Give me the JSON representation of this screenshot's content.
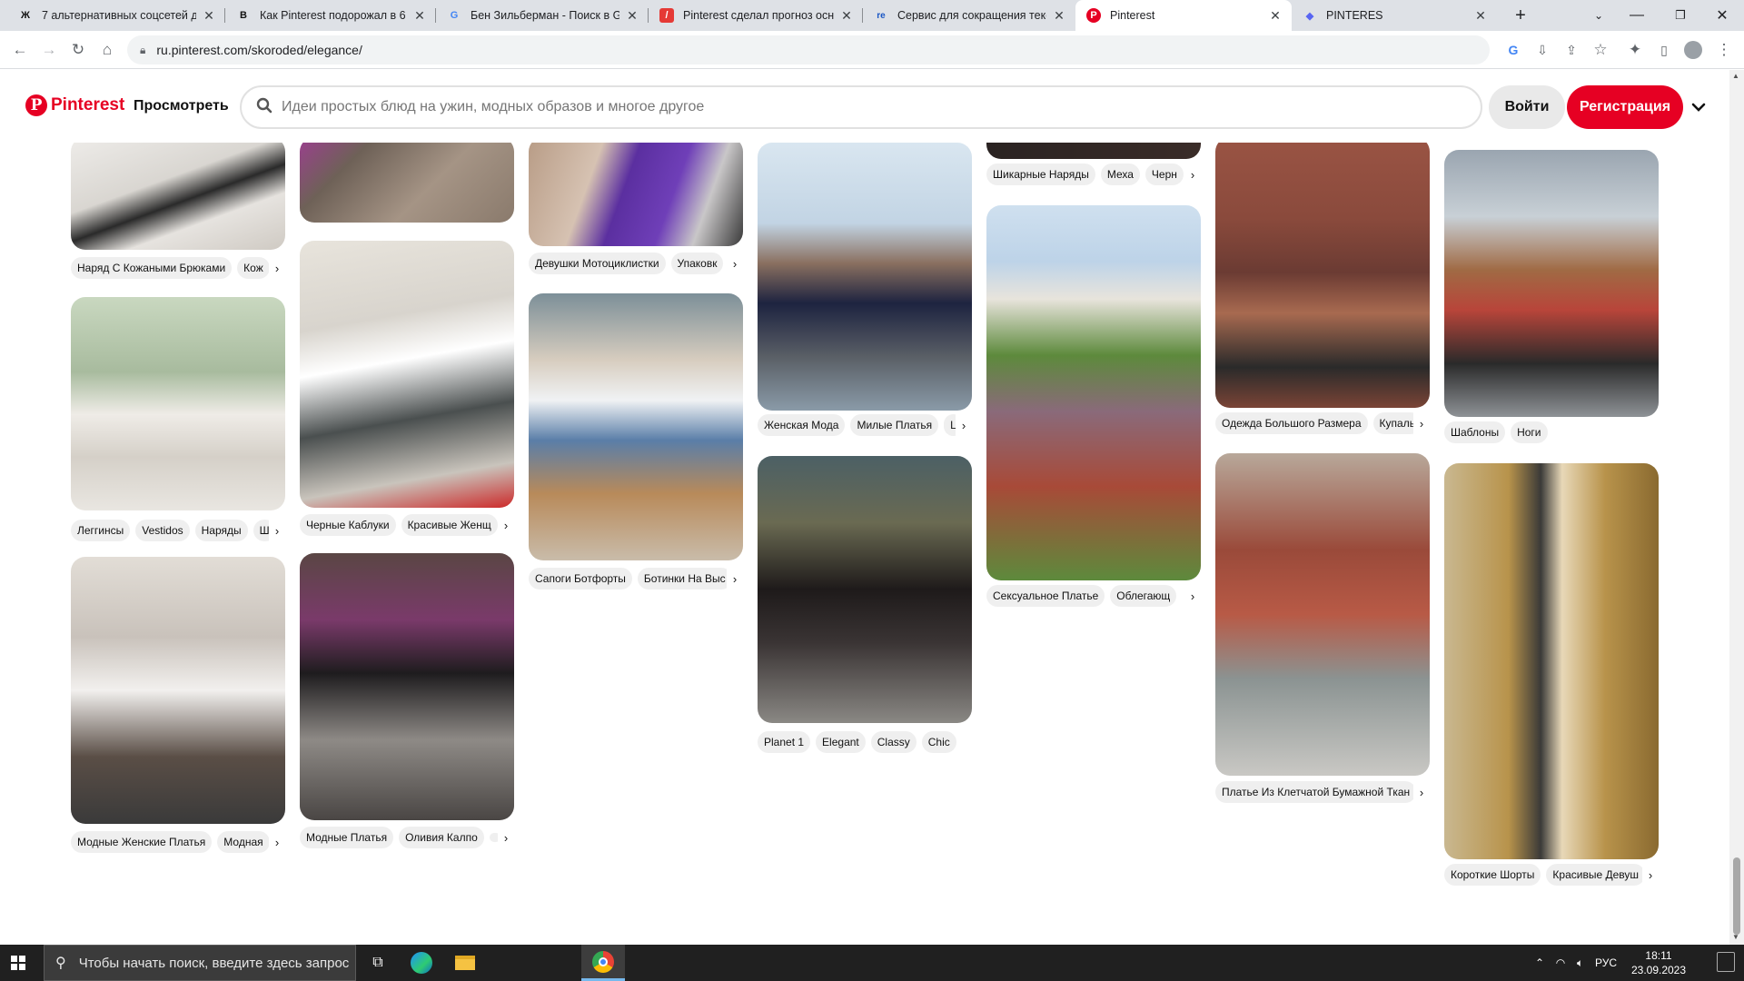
{
  "browser": {
    "tabs": [
      {
        "title": "7 альтернативных соцсетей дл",
        "favicon": "Ж",
        "fav_bg": "#ffffff",
        "fav_fg": "#111111"
      },
      {
        "title": "Как Pinterest подорожал в 6 р",
        "favicon": "B",
        "fav_bg": "#ffffff",
        "fav_fg": "#111111"
      },
      {
        "title": "Бен Зильберман - Поиск в Goo",
        "favicon": "G",
        "fav_bg": "#ffffff",
        "fav_fg": "#4285f4"
      },
      {
        "title": "Pinterest сделал прогноз осно",
        "favicon": "/",
        "fav_bg": "#e53935",
        "fav_fg": "#ffffff"
      },
      {
        "title": "Сервис для сокращения текста",
        "favicon": "re",
        "fav_bg": "#ffffff",
        "fav_fg": "#1a56c4"
      },
      {
        "title": "Pinterest",
        "favicon": "P",
        "fav_bg": "#e60023",
        "fav_fg": "#ffffff"
      },
      {
        "title": "PINTERES",
        "favicon": "◆",
        "fav_bg": "#ffffff",
        "fav_fg": "#5865f2"
      }
    ],
    "active_tab": 5,
    "url": "ru.pinterest.com/skoroded/elegance/"
  },
  "header": {
    "logo_text": "Pinterest",
    "browse_label": "Просмотреть",
    "search_placeholder": "Идеи простых блюд на ужин, модных образов и многое другое",
    "login_label": "Войти",
    "signup_label": "Регистрация"
  },
  "pins": {
    "col1": [
      {
        "tags": [
          "Наряд С Кожаными Брюками",
          "Кож"
        ],
        "colors": [
          "#e8e6e3",
          "#2b2b2b"
        ]
      },
      {
        "tags": [
          "Леггинсы",
          "Vestidos",
          "Наряды",
          "Ш"
        ],
        "colors": [
          "#b8c9b0",
          "#e9e6e1"
        ]
      },
      {
        "tags": [
          "Модные Женские Платья",
          "Модная"
        ],
        "colors": [
          "#c9c2bb",
          "#3a3a3a"
        ]
      }
    ],
    "col2": [
      {
        "tags": [],
        "colors": [
          "#7a6b5f",
          "#a59485"
        ]
      },
      {
        "tags": [
          "Черные Каблуки",
          "Красивые Женщ"
        ],
        "colors": [
          "#d8d4cd",
          "#4a4f4f"
        ]
      },
      {
        "tags": [
          "Модные Платья",
          "Оливия Калпо",
          ""
        ],
        "colors": [
          "#4a3c3a",
          "#1e1c1e"
        ]
      }
    ],
    "col3": [
      {
        "tags": [
          "Девушки Мотоциклистки",
          "Упаковк"
        ],
        "colors": [
          "#5b2fa0",
          "#c9c7c8"
        ]
      },
      {
        "tags": [
          "Сапоги Ботфорты",
          "Ботинки На Выс"
        ],
        "colors": [
          "#d7cdbf",
          "#7c8f98"
        ]
      }
    ],
    "col4": [
      {
        "tags": [
          "Женская Мода",
          "Милые Платья",
          "L"
        ],
        "colors": [
          "#c2d4e4",
          "#5a5f66"
        ]
      },
      {
        "tags": [
          "Planet 1",
          "Elegant",
          "Classy",
          "Chic"
        ],
        "colors": [
          "#4c6065",
          "#1e1a1a"
        ]
      }
    ],
    "col5": [
      {
        "tags": [
          "Шикарные Наряды",
          "Меха",
          "Черн"
        ],
        "colors": [
          "#2a2322",
          "#3a2c28"
        ]
      },
      {
        "tags": [
          "Сексуальное Платье",
          "Облегающ"
        ],
        "colors": [
          "#bdd3e8",
          "#5d8a3c"
        ]
      }
    ],
    "col6": [
      {
        "tags": [
          "Одежда Большого Размера",
          "Купаль"
        ],
        "colors": [
          "#8a4a3c",
          "#6b3b33"
        ]
      },
      {
        "tags": [
          "Платье Из Клетчатой Бумажной Ткан"
        ],
        "colors": [
          "#b8a89a",
          "#8b9392"
        ]
      }
    ],
    "col7": [
      {
        "tags": [
          "Шаблоны",
          "Ноги"
        ],
        "colors": [
          "#9aa5b0",
          "#6a5a4a"
        ]
      },
      {
        "tags": [
          "Короткие Шорты",
          "Красивые Девуш"
        ],
        "colors": [
          "#b8934b",
          "#3b3a38"
        ]
      }
    ]
  },
  "taskbar": {
    "search_placeholder": "Чтобы начать поиск, введите здесь запрос",
    "language": "РУС",
    "time": "18:11",
    "date": "23.09.2023"
  }
}
